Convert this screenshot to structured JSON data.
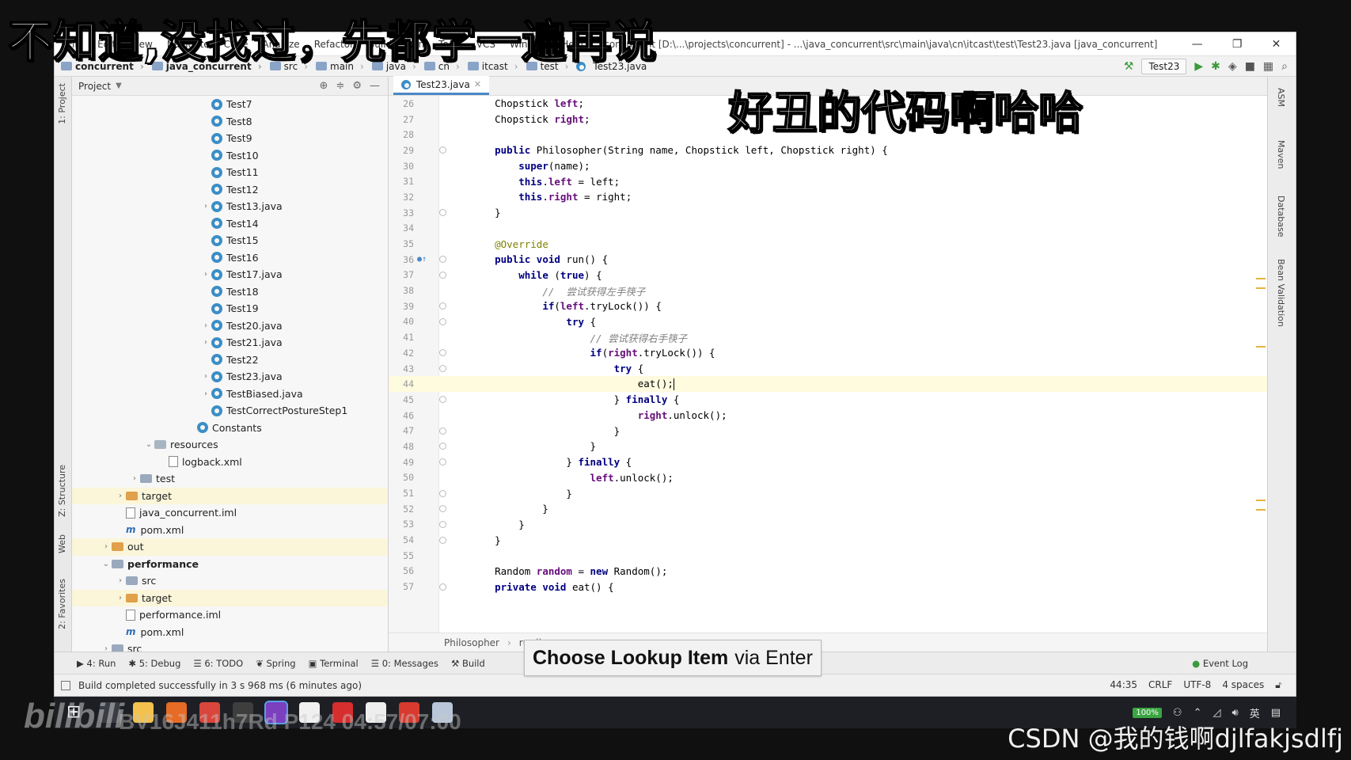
{
  "overlay": {
    "caption_top": "不知道,没找过，先都学一遍再说",
    "caption_mid": "好丑的代码啊哈哈",
    "bilibili_logo": "bilibili",
    "video_stamp": "BV16J411h7Rd P124 04:57/07:00",
    "watermark": "CSDN @我的钱啊djlfakjsdlfj"
  },
  "titlebar": {
    "menu": [
      "File",
      "Edit",
      "View",
      "Navigate",
      "Code",
      "Analyze",
      "Refactor",
      "Build",
      "Run",
      "Tools",
      "VCS",
      "Window",
      "Help"
    ],
    "window_title": "concurrent [D:\\...\\projects\\concurrent] - ...\\java_concurrent\\src\\main\\java\\cn\\itcast\\test\\Test23.java [java_concurrent]",
    "minimize": "—",
    "restore": "❐",
    "close": "✕"
  },
  "breadcrumb": [
    "concurrent",
    "java_concurrent",
    "src",
    "main",
    "java",
    "cn",
    "itcast",
    "test",
    "Test23.java"
  ],
  "run_config": "Test23",
  "project_panel": {
    "title": "Project",
    "tree": [
      {
        "label": "Test7",
        "indent": 9,
        "icon": "class"
      },
      {
        "label": "Test8",
        "indent": 9,
        "icon": "class"
      },
      {
        "label": "Test9",
        "indent": 9,
        "icon": "class"
      },
      {
        "label": "Test10",
        "indent": 9,
        "icon": "class"
      },
      {
        "label": "Test11",
        "indent": 9,
        "icon": "class"
      },
      {
        "label": "Test12",
        "indent": 9,
        "icon": "class"
      },
      {
        "label": "Test13.java",
        "indent": 9,
        "icon": "class",
        "expandable": true
      },
      {
        "label": "Test14",
        "indent": 9,
        "icon": "class"
      },
      {
        "label": "Test15",
        "indent": 9,
        "icon": "class"
      },
      {
        "label": "Test16",
        "indent": 9,
        "icon": "class"
      },
      {
        "label": "Test17.java",
        "indent": 9,
        "icon": "class",
        "expandable": true
      },
      {
        "label": "Test18",
        "indent": 9,
        "icon": "class"
      },
      {
        "label": "Test19",
        "indent": 9,
        "icon": "class"
      },
      {
        "label": "Test20.java",
        "indent": 9,
        "icon": "class",
        "expandable": true
      },
      {
        "label": "Test21.java",
        "indent": 9,
        "icon": "class",
        "expandable": true
      },
      {
        "label": "Test22",
        "indent": 9,
        "icon": "class"
      },
      {
        "label": "Test23.java",
        "indent": 9,
        "icon": "class",
        "expandable": true
      },
      {
        "label": "TestBiased.java",
        "indent": 9,
        "icon": "class",
        "expandable": true
      },
      {
        "label": "TestCorrectPostureStep1",
        "indent": 9,
        "icon": "class"
      },
      {
        "label": "Constants",
        "indent": 8,
        "icon": "class"
      },
      {
        "label": "resources",
        "indent": 5,
        "icon": "res",
        "expanded": true
      },
      {
        "label": "logback.xml",
        "indent": 6,
        "icon": "file"
      },
      {
        "label": "test",
        "indent": 4,
        "icon": "folder",
        "expandable": true
      },
      {
        "label": "target",
        "indent": 3,
        "icon": "orange",
        "expandable": true,
        "highlight": true
      },
      {
        "label": "java_concurrent.iml",
        "indent": 3,
        "icon": "file"
      },
      {
        "label": "pom.xml",
        "indent": 3,
        "icon": "maven"
      },
      {
        "label": "out",
        "indent": 2,
        "icon": "orange",
        "expandable": true,
        "highlight": true
      },
      {
        "label": "performance",
        "indent": 2,
        "icon": "folder",
        "expanded": true,
        "bold": true
      },
      {
        "label": "src",
        "indent": 3,
        "icon": "folder",
        "expandable": true
      },
      {
        "label": "target",
        "indent": 3,
        "icon": "orange",
        "expandable": true,
        "highlight": true
      },
      {
        "label": "performance.iml",
        "indent": 3,
        "icon": "file"
      },
      {
        "label": "pom.xml",
        "indent": 3,
        "icon": "maven"
      },
      {
        "label": "src",
        "indent": 2,
        "icon": "folder",
        "expandable": true
      }
    ]
  },
  "editor": {
    "tab": "Test23.java",
    "current_line": 44,
    "lines": [
      {
        "n": 26,
        "html": "    Chopstick <span class='fld'>left</span>;"
      },
      {
        "n": 27,
        "html": "    Chopstick <span class='fld'>right</span>;"
      },
      {
        "n": 28,
        "html": ""
      },
      {
        "n": 29,
        "html": "    <span class='kw'>public</span> Philosopher(String name, Chopstick left, Chopstick right) {",
        "fold": true
      },
      {
        "n": 30,
        "html": "        <span class='kw'>super</span>(name);"
      },
      {
        "n": 31,
        "html": "        <span class='kw'>this</span>.<span class='fld'>left</span> = left;"
      },
      {
        "n": 32,
        "html": "        <span class='kw'>this</span>.<span class='fld'>right</span> = right;"
      },
      {
        "n": 33,
        "html": "    }",
        "fold": true
      },
      {
        "n": 34,
        "html": ""
      },
      {
        "n": 35,
        "html": "    <span class='ann'>@Override</span>"
      },
      {
        "n": 36,
        "html": "    <span class='kw'>public void</span> run() {",
        "fold": true,
        "marker": true
      },
      {
        "n": 37,
        "html": "        <span class='kw'>while</span> (<span class='kw'>true</span>) {",
        "fold": true
      },
      {
        "n": 38,
        "html": "            <span class='cmt'>//  尝试获得左手筷子</span>"
      },
      {
        "n": 39,
        "html": "            <span class='kw'>if</span>(<span class='fld'>left</span>.tryLock()) {",
        "fold": true
      },
      {
        "n": 40,
        "html": "                <span class='kw'>try</span> {",
        "fold": true
      },
      {
        "n": 41,
        "html": "                    <span class='cmt'>// 尝试获得右手筷子</span>"
      },
      {
        "n": 42,
        "html": "                    <span class='kw'>if</span>(<span class='fld'>right</span>.tryLock()) {",
        "fold": true
      },
      {
        "n": 43,
        "html": "                        <span class='kw'>try</span> {",
        "fold": true
      },
      {
        "n": 44,
        "html": "                            eat();<span class='caret'></span>"
      },
      {
        "n": 45,
        "html": "                        } <span class='kw'>finally</span> {",
        "fold": true
      },
      {
        "n": 46,
        "html": "                            <span class='fld'>right</span>.unlock();"
      },
      {
        "n": 47,
        "html": "                        }",
        "fold": true
      },
      {
        "n": 48,
        "html": "                    }",
        "fold": true
      },
      {
        "n": 49,
        "html": "                } <span class='kw'>finally</span> {",
        "fold": true
      },
      {
        "n": 50,
        "html": "                    <span class='fld'>left</span>.unlock();"
      },
      {
        "n": 51,
        "html": "                }",
        "fold": true
      },
      {
        "n": 52,
        "html": "            }",
        "fold": true
      },
      {
        "n": 53,
        "html": "        }",
        "fold": true
      },
      {
        "n": 54,
        "html": "    }",
        "fold": true
      },
      {
        "n": 55,
        "html": ""
      },
      {
        "n": 56,
        "html": "    Random <span class='fld'>random</span> = <span class='kw'>new</span> Random();"
      },
      {
        "n": 57,
        "html": "    <span class='kw'>private void</span> eat() {",
        "fold": true
      }
    ],
    "footer_crumbs": [
      "Philosopher",
      "run()"
    ]
  },
  "right_tabs": [
    "ASM",
    "Maven",
    "Database",
    "Bean Validation"
  ],
  "left_tabs": [
    "1: Project",
    "Z: Structure",
    "Web",
    "2: Favorites"
  ],
  "bottom_tools": [
    "4: Run",
    "5: Debug",
    "6: TODO",
    "Spring",
    "Terminal",
    "0: Messages",
    "Build"
  ],
  "event_log": "Event Log",
  "status": {
    "message": "Build completed successfully in 3 s 968 ms (6 minutes ago)",
    "position": "44:35",
    "line_sep": "CRLF",
    "encoding": "UTF-8",
    "indent": "4 spaces"
  },
  "tooltip": {
    "bold": "Choose Lookup Item",
    "rest": "via Enter"
  },
  "taskbar": {
    "apps": [
      {
        "name": "start",
        "color": "#ffffff"
      },
      {
        "name": "task-view",
        "color": "#3a3d44"
      },
      {
        "name": "explorer",
        "color": "#f2c14e"
      },
      {
        "name": "firefox",
        "color": "#e66b24"
      },
      {
        "name": "chrome",
        "color": "#d9463b"
      },
      {
        "name": "terminal",
        "color": "#3e3e3e"
      },
      {
        "name": "intellij",
        "color": "#7b3fc0"
      },
      {
        "name": "typora",
        "color": "#f0f0f0"
      },
      {
        "name": "xmind",
        "color": "#d62e2e"
      },
      {
        "name": "panda",
        "color": "#eeeeee"
      },
      {
        "name": "recorder",
        "color": "#d93a2f"
      },
      {
        "name": "docs",
        "color": "#b9c6d9"
      }
    ],
    "battery": "100%",
    "ime": "英"
  }
}
